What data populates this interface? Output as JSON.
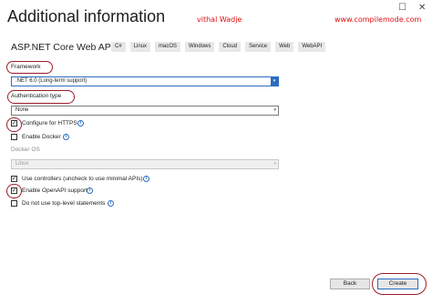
{
  "window": {
    "maximize_glyph": "☐",
    "close_glyph": "✕"
  },
  "header": {
    "title": "Additional information",
    "author": "vithal Wadje",
    "site": "www.compilemode.com"
  },
  "project": {
    "name": "ASP.NET Core Web API",
    "tags": [
      "C#",
      "Linux",
      "macOS",
      "Windows",
      "Cloud",
      "Service",
      "Web",
      "WebAPI"
    ]
  },
  "framework": {
    "label": "Framework",
    "value": ".NET 6.0 (Long-term support)"
  },
  "auth": {
    "label": "Authentication type",
    "value": "None"
  },
  "options": {
    "https": {
      "label": "Configure for HTTPS",
      "checked": true
    },
    "docker": {
      "label": "Enable Docker",
      "checked": false
    }
  },
  "docker_os": {
    "label": "Docker OS",
    "value": "Linux"
  },
  "options2": {
    "controllers": {
      "label": "Use controllers (uncheck to use minimal APIs)",
      "checked": true
    },
    "openapi": {
      "label": "Enable OpenAPI support",
      "checked": true
    },
    "toplevel": {
      "label": "Do not use top-level statements",
      "checked": false
    }
  },
  "footer": {
    "back_label": "Back",
    "create_label": "Create"
  },
  "icons": {
    "check": "✓",
    "info": "i",
    "dropdown": "▾"
  },
  "colors": {
    "accent": "#2d6cc0",
    "annotation": "#9b1b2a",
    "watermark": "#e01010"
  }
}
